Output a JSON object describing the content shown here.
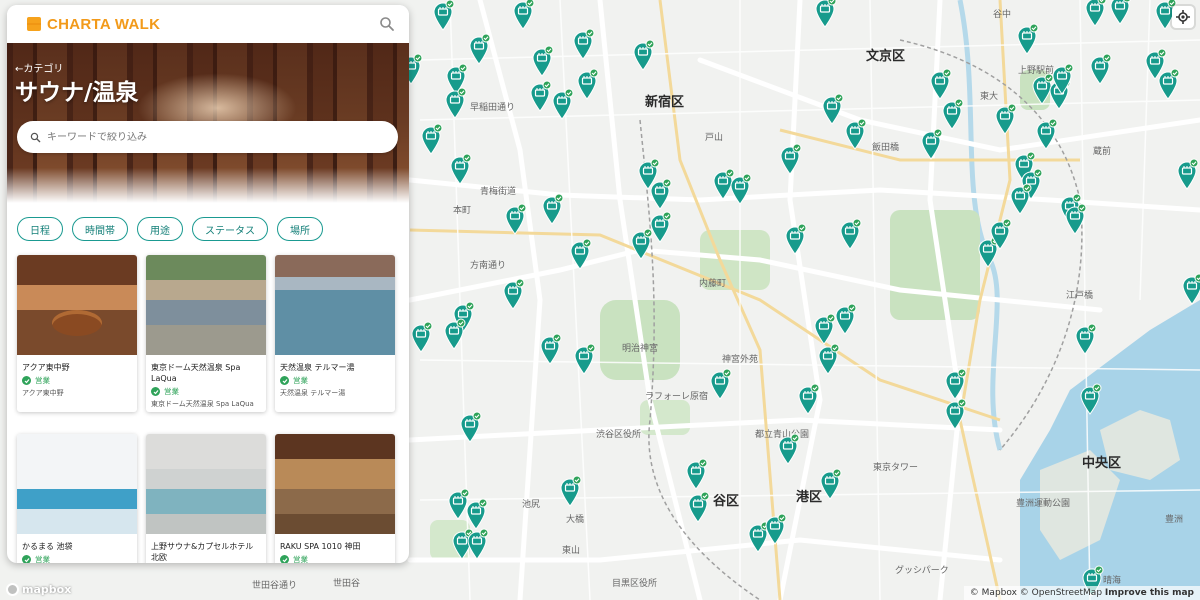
{
  "app": {
    "logo_text": "CHARTA WALK",
    "brand_color": "#f29a1a",
    "accent_color": "#1a9a91"
  },
  "header": {
    "search_icon": "search-icon"
  },
  "hero": {
    "back_label": "←カテゴリ",
    "title": "サウナ/温泉",
    "search_placeholder": "キーワードで絞り込み"
  },
  "filters": [
    {
      "label": "日程"
    },
    {
      "label": "時間帯"
    },
    {
      "label": "用途"
    },
    {
      "label": "ステータス"
    },
    {
      "label": "場所"
    }
  ],
  "cards": [
    {
      "name": "アクア東中野",
      "status": "営業",
      "subtitle": "アクア東中野"
    },
    {
      "name": "東京ドーム天然温泉 Spa LaQua",
      "status": "営業",
      "subtitle": "東京ドーム天然温泉 Spa LaQua"
    },
    {
      "name": "天然温泉 テルマー湯",
      "status": "営業",
      "subtitle": "天然温泉 テルマー湯"
    },
    {
      "name": "かるまる 池袋",
      "status": "営業",
      "subtitle": ""
    },
    {
      "name": "上野サウナ&カプセルホテル北欧",
      "status": "",
      "subtitle": ""
    },
    {
      "name": "RAKU SPA 1010 神田",
      "status": "営業",
      "subtitle": ""
    }
  ],
  "map": {
    "wards": [
      {
        "name": "文京区"
      },
      {
        "name": "新宿区"
      },
      {
        "name": "中央区"
      },
      {
        "name": "港区"
      },
      {
        "name": "谷区"
      }
    ],
    "places": [
      {
        "name": "上野駅前"
      },
      {
        "name": "東大"
      },
      {
        "name": "谷中"
      },
      {
        "name": "蔵前"
      },
      {
        "name": "飯田橋"
      },
      {
        "name": "内藤町"
      },
      {
        "name": "明治神宮"
      },
      {
        "name": "神宮外苑"
      },
      {
        "name": "ラフォーレ原宿"
      },
      {
        "name": "渋谷区役所"
      },
      {
        "name": "都立青山公園"
      },
      {
        "name": "東京タワー"
      },
      {
        "name": "豊洲運動公園"
      },
      {
        "name": "江戸橋"
      },
      {
        "name": "早稲田通り"
      },
      {
        "name": "青梅街道"
      },
      {
        "name": "方南通り"
      },
      {
        "name": "池尻"
      },
      {
        "name": "大橋"
      },
      {
        "name": "東山"
      },
      {
        "name": "世田谷"
      },
      {
        "name": "目黒区役所"
      },
      {
        "name": "戸山"
      },
      {
        "name": "本町"
      },
      {
        "name": "晴海"
      },
      {
        "name": "豊洲"
      },
      {
        "name": "グッシパーク"
      },
      {
        "name": "世田谷通り"
      }
    ],
    "marker_color": "#179b8c",
    "locate_icon": "locate-icon",
    "attribution": {
      "mapbox": "© Mapbox",
      "osm": "© OpenStreetMap",
      "improve": "Improve this map"
    },
    "logo_text": "mapbox"
  }
}
